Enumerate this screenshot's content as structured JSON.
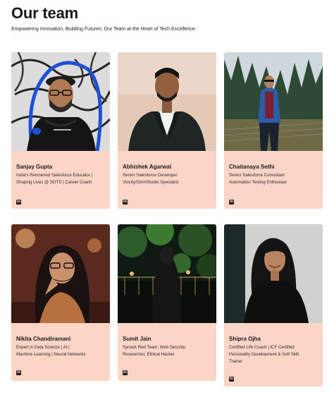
{
  "page": {
    "title": "Our team",
    "subtitle": "Empowering Innovation, Building Futures: Our Team at the Heart of Tech Excellence."
  },
  "team": [
    {
      "name": "Sanjay Gupta",
      "lines": [
        "India's Renowned Salesforce Educator |",
        "Shaping Lives @ SGTS | Career Coach"
      ],
      "icon": "linkedin-icon"
    },
    {
      "name": "Abhishek Agarwal",
      "lines": [
        "Senior Salesforce Developer",
        "Vlocity/OmniStudio Specialist"
      ],
      "icon": "linkedin-icon"
    },
    {
      "name": "Chaitanaya Sethi",
      "lines": [
        "Senior Salesforce Consultant",
        "Automation Testing Enthusiast"
      ],
      "icon": "linkedin-icon"
    },
    {
      "name": "Nikita Chandiramani",
      "lines": [
        "Expert in Data Science | AI |",
        "Machine Learning | Neural Networks"
      ],
      "icon": "linkedin-icon"
    },
    {
      "name": "Sumit Jain",
      "lines": [
        "Synack Red Team, Web Security",
        "Researcher, Ethical Hacker"
      ],
      "icon": "linkedin-icon"
    },
    {
      "name": "Shipra Ojha",
      "lines": [
        "Certified Life Coach | ICF Certified",
        "Personality Development & Soft Skill",
        "Trainer"
      ],
      "icon": "linkedin-icon"
    }
  ],
  "linkedin_glyph": "in",
  "colors": {
    "card_bg": "#fdd5c6",
    "text": "#1a1a1a"
  }
}
